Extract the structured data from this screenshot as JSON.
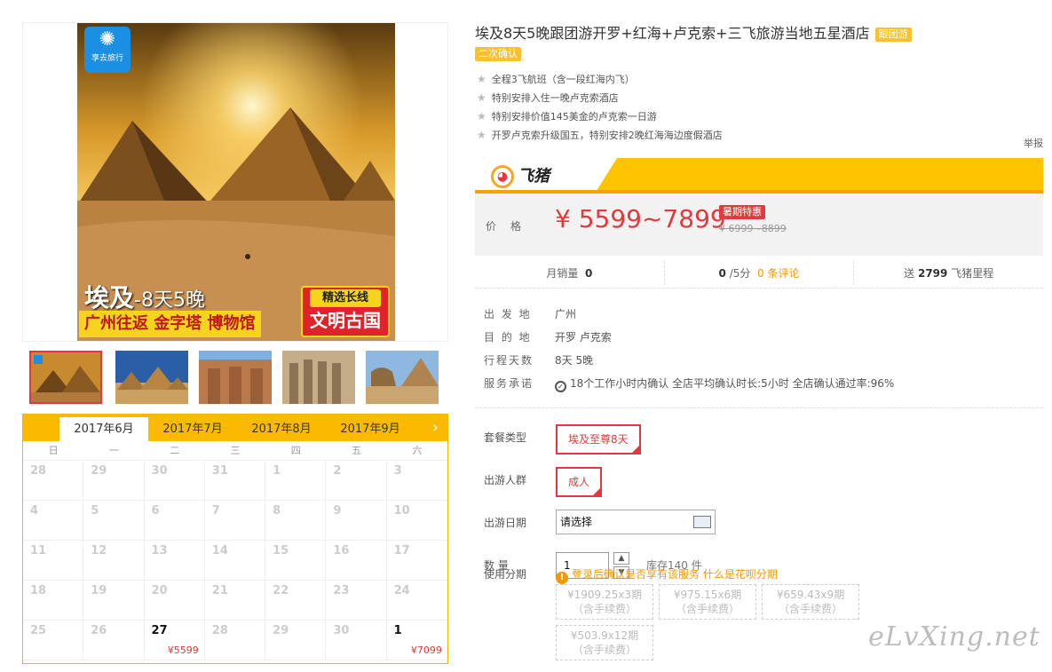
{
  "poster": {
    "logo_text": "享去旅行",
    "title_big": "埃及",
    "title_small": "-8天5晚",
    "route": "广州往返 金字塔 博物馆",
    "tag_top": "精选长线",
    "tag_bottom": "文明古国"
  },
  "calendar": {
    "months": [
      "2017年6月",
      "2017年7月",
      "2017年8月",
      "2017年9月"
    ],
    "next_icon": "chevron-right-icon",
    "weekdays": [
      "日",
      "一",
      "二",
      "三",
      "四",
      "五",
      "六"
    ],
    "days": [
      {
        "d": "28"
      },
      {
        "d": "29"
      },
      {
        "d": "30"
      },
      {
        "d": "31"
      },
      {
        "d": "1"
      },
      {
        "d": "2"
      },
      {
        "d": "3"
      },
      {
        "d": "4"
      },
      {
        "d": "5"
      },
      {
        "d": "6"
      },
      {
        "d": "7"
      },
      {
        "d": "8"
      },
      {
        "d": "9"
      },
      {
        "d": "10"
      },
      {
        "d": "11"
      },
      {
        "d": "12"
      },
      {
        "d": "13"
      },
      {
        "d": "14"
      },
      {
        "d": "15"
      },
      {
        "d": "16"
      },
      {
        "d": "17"
      },
      {
        "d": "18"
      },
      {
        "d": "19"
      },
      {
        "d": "20"
      },
      {
        "d": "21"
      },
      {
        "d": "22"
      },
      {
        "d": "23"
      },
      {
        "d": "24"
      },
      {
        "d": "25"
      },
      {
        "d": "26"
      },
      {
        "d": "27",
        "price": "¥5599",
        "avail": true
      },
      {
        "d": "28"
      },
      {
        "d": "29"
      },
      {
        "d": "30"
      },
      {
        "d": "1",
        "price": "¥7099",
        "avail": true
      }
    ]
  },
  "product": {
    "title": "埃及8天5晚跟团游开罗+红海+卢克索+三飞旅游当地五星酒店",
    "tag_group": "跟团游",
    "tag_confirm": "二次确认",
    "features": [
      "全程3飞航班（含一段红海内飞）",
      "特别安排入住一晚卢克索酒店",
      "特别安排价值145美金的卢克索一日游",
      "开罗卢克索升级国五，特别安排2晚红海海边度假酒店"
    ],
    "report": "举报"
  },
  "brand": {
    "name": "飞猪"
  },
  "price": {
    "label": "价格",
    "value": "¥ 5599~7899",
    "promo": "暑期特惠",
    "old": "¥ 6999~8899"
  },
  "stats": {
    "sales_label": "月销量",
    "sales_value": "0",
    "rating_value": "0",
    "rating_suffix": "/5分",
    "comments": "0 条评论",
    "miles_prefix": "送",
    "miles_value": "2799",
    "miles_suffix": "飞猪里程"
  },
  "info": [
    {
      "label": "出 发 地",
      "value": "广州"
    },
    {
      "label": "目 的 地",
      "value": "开罗   卢克索"
    },
    {
      "label": "行程天数",
      "value": "8天 5晚"
    },
    {
      "label": "服务承诺",
      "value": "18个工作小时内确认    全店平均确认时长:5小时    全店确认通过率:96%"
    }
  ],
  "options": {
    "package_label": "套餐类型",
    "package_value": "埃及至尊8天",
    "crowd_label": "出游人群",
    "crowd_value": "成人",
    "date_label": "出游日期",
    "date_placeholder": "请选择",
    "qty_label": "数    量",
    "qty_value": "1",
    "stock": "库存140 件"
  },
  "installment": {
    "label": "使用分期",
    "note_login": "登录后确认是否享有该服务",
    "note_link": "什么是花呗分期",
    "plans": [
      {
        "line1": "¥1909.25x3期",
        "line2": "（含手续费）"
      },
      {
        "line1": "¥975.15x6期",
        "line2": "（含手续费）"
      },
      {
        "line1": "¥659.43x9期",
        "line2": "（含手续费）"
      },
      {
        "line1": "¥503.9x12期",
        "line2": "（含手续费）"
      }
    ]
  },
  "watermark": "eLvXing.net",
  "colors": {
    "accent": "#e4393c",
    "brand_yellow": "#ffc400",
    "orange": "#f39800"
  }
}
